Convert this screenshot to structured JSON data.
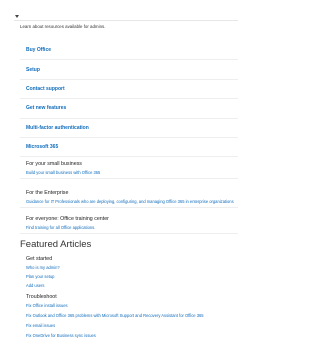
{
  "collapse_icon": "collapse-triangle-icon",
  "intro_text": "Learn about resources available for admins.",
  "quick_links": [
    {
      "label": "Buy Office"
    },
    {
      "label": "Setup"
    },
    {
      "label": "Contact support"
    },
    {
      "label": "Get new features"
    },
    {
      "label": "Multi-factor authentication"
    },
    {
      "label": "Microsoft 365"
    }
  ],
  "cards": [
    {
      "title": "For your small business",
      "link": "Build your small business with Office 365"
    },
    {
      "title": "For the Enterprise",
      "link": "Guidance for IT Professionals who are deploying, configuring, and managing Office 365 in enterprise organizations"
    },
    {
      "title": "For everyone: Office training center",
      "link": "Find training for all Office applications."
    }
  ],
  "featured": {
    "heading": "Featured Articles",
    "sections": [
      {
        "title": "Get started",
        "links": [
          "Who is my admin?",
          "Plan your setup",
          "Add users"
        ]
      },
      {
        "title": "Troubleshoot",
        "links": [
          "Fix Office install issues",
          "Fix Outlook and Office 365 problems with Microsoft Support and Recovery Assistant for Office 365",
          "Fix email issues",
          "Fix OneDrive for Business sync issues"
        ]
      }
    ]
  },
  "colors": {
    "link": "#0f6cbd",
    "text": "#262626",
    "divider": "#eeeeee"
  }
}
